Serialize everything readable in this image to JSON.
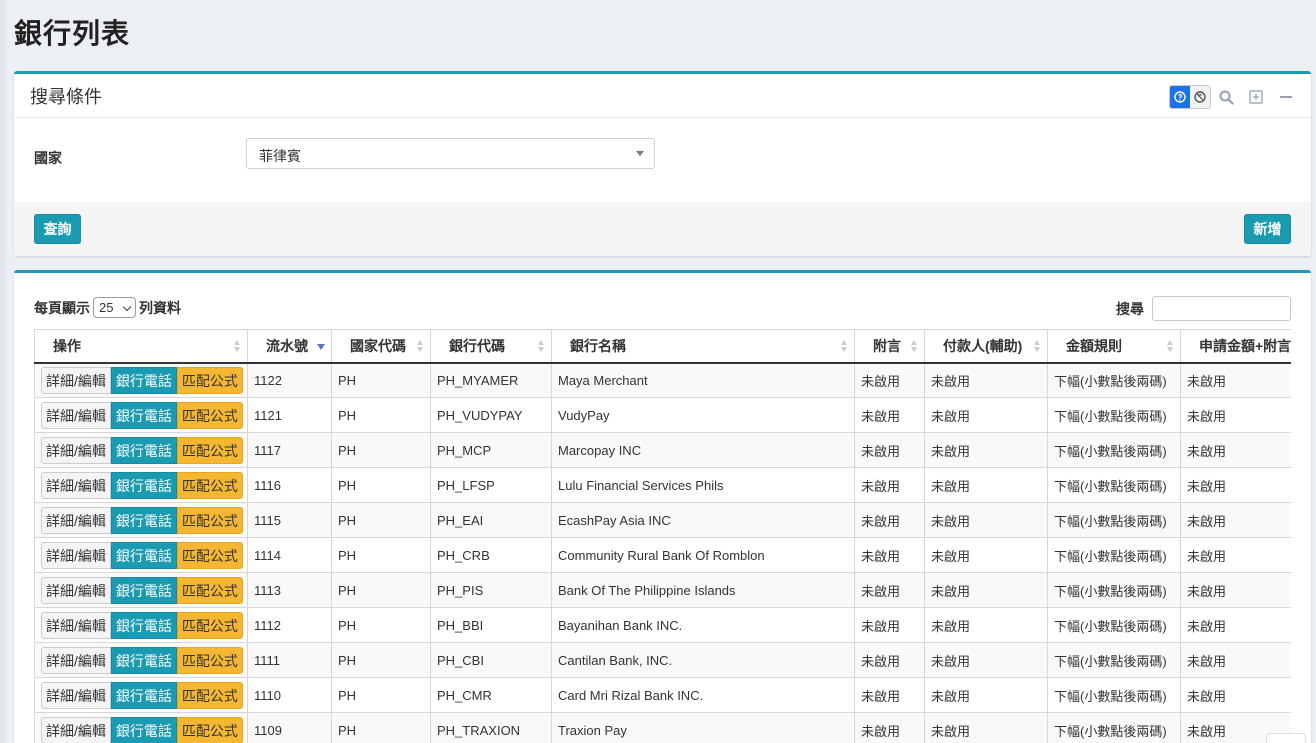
{
  "page": {
    "title": "銀行列表"
  },
  "search_panel": {
    "title": "搜尋條件",
    "country_label": "國家",
    "country_value": "菲律賓",
    "query_button": "查詢",
    "add_button": "新增"
  },
  "table_controls": {
    "length_prefix": "每頁顯示",
    "length_value": "25",
    "length_suffix": "列資料",
    "search_label": "搜尋"
  },
  "table": {
    "columns": [
      "操作",
      "流水號",
      "國家代碼",
      "銀行代碼",
      "銀行名稱",
      "附言",
      "付款人(輔助)",
      "金額規則",
      "申請金額+附言"
    ],
    "action_labels": {
      "edit": "詳細/編輯",
      "phone": "銀行電話",
      "formula": "匹配公式"
    },
    "rows": [
      {
        "id": "1122",
        "country": "PH",
        "code": "PH_MYAMER",
        "name": "Maya Merchant",
        "memo": "未啟用",
        "payer": "未啟用",
        "rule": "下幅(小數點後兩碼)",
        "apply": "未啟用"
      },
      {
        "id": "1121",
        "country": "PH",
        "code": "PH_VUDYPAY",
        "name": "VudyPay",
        "memo": "未啟用",
        "payer": "未啟用",
        "rule": "下幅(小數點後兩碼)",
        "apply": "未啟用"
      },
      {
        "id": "1117",
        "country": "PH",
        "code": "PH_MCP",
        "name": "Marcopay INC",
        "memo": "未啟用",
        "payer": "未啟用",
        "rule": "下幅(小數點後兩碼)",
        "apply": "未啟用"
      },
      {
        "id": "1116",
        "country": "PH",
        "code": "PH_LFSP",
        "name": "Lulu Financial Services Phils",
        "memo": "未啟用",
        "payer": "未啟用",
        "rule": "下幅(小數點後兩碼)",
        "apply": "未啟用"
      },
      {
        "id": "1115",
        "country": "PH",
        "code": "PH_EAI",
        "name": "EcashPay Asia INC",
        "memo": "未啟用",
        "payer": "未啟用",
        "rule": "下幅(小數點後兩碼)",
        "apply": "未啟用"
      },
      {
        "id": "1114",
        "country": "PH",
        "code": "PH_CRB",
        "name": "Community Rural Bank Of Romblon",
        "memo": "未啟用",
        "payer": "未啟用",
        "rule": "下幅(小數點後兩碼)",
        "apply": "未啟用"
      },
      {
        "id": "1113",
        "country": "PH",
        "code": "PH_PIS",
        "name": "Bank Of The Philippine Islands",
        "memo": "未啟用",
        "payer": "未啟用",
        "rule": "下幅(小數點後兩碼)",
        "apply": "未啟用"
      },
      {
        "id": "1112",
        "country": "PH",
        "code": "PH_BBI",
        "name": "Bayanihan Bank INC.",
        "memo": "未啟用",
        "payer": "未啟用",
        "rule": "下幅(小數點後兩碼)",
        "apply": "未啟用"
      },
      {
        "id": "1111",
        "country": "PH",
        "code": "PH_CBI",
        "name": "Cantilan Bank, INC.",
        "memo": "未啟用",
        "payer": "未啟用",
        "rule": "下幅(小數點後兩碼)",
        "apply": "未啟用"
      },
      {
        "id": "1110",
        "country": "PH",
        "code": "PH_CMR",
        "name": "Card Mri Rizal Bank INC.",
        "memo": "未啟用",
        "payer": "未啟用",
        "rule": "下幅(小數點後兩碼)",
        "apply": "未啟用"
      },
      {
        "id": "1109",
        "country": "PH",
        "code": "PH_TRAXION",
        "name": "Traxion Pay",
        "memo": "未啟用",
        "payer": "未啟用",
        "rule": "下幅(小數點後兩碼)",
        "apply": "未啟用"
      }
    ]
  },
  "colors": {
    "accent": "#1a9bb2",
    "warning": "#f5b731",
    "toggle_active": "#1a73e8"
  },
  "icons": {
    "toggle_on": "toggle-on-icon",
    "toggle_off": "toggle-off-icon",
    "search": "search-icon",
    "expand": "expand-icon",
    "collapse": "collapse-icon"
  }
}
